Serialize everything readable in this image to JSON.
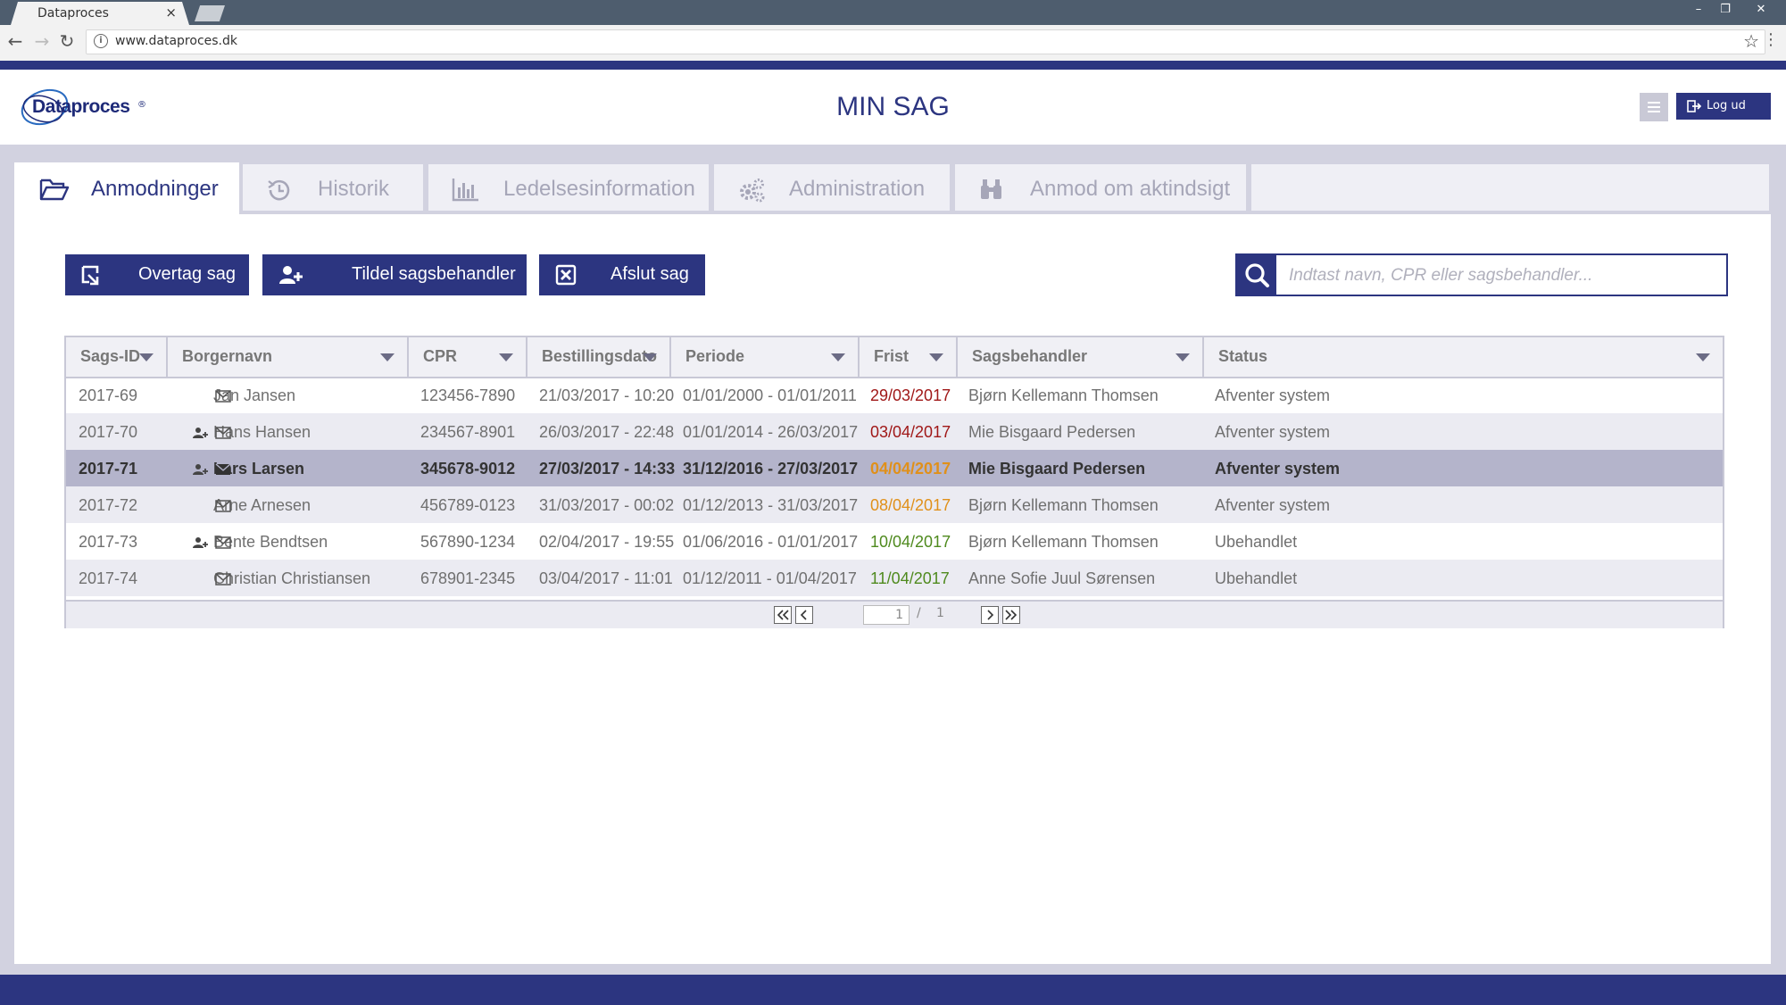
{
  "browser": {
    "tab_title": "Dataproces",
    "tab_close": "×",
    "url": "www.dataproces.dk",
    "window_controls": [
      "–",
      "❐",
      "✕"
    ]
  },
  "site": {
    "logo_text": "Dataproces",
    "logo_mark": "®",
    "page_title": "MIN SAG",
    "logout_label": "Log ud"
  },
  "tabs": [
    {
      "label": "Anmodninger",
      "icon": "folder-open-icon",
      "active": true
    },
    {
      "label": "Historik",
      "icon": "history-icon",
      "active": false
    },
    {
      "label": "Ledelsesinformation",
      "icon": "bar-chart-icon",
      "active": false
    },
    {
      "label": "Administration",
      "icon": "gears-icon",
      "active": false
    },
    {
      "label": "Anmod om aktindsigt",
      "icon": "binoculars-icon",
      "active": false
    }
  ],
  "actions": {
    "take_over": "Overtag sag",
    "assign": "Tildel sagsbehandler",
    "close": "Afslut sag"
  },
  "search": {
    "placeholder": "Indtast navn, CPR eller sagsbehandler..."
  },
  "table": {
    "columns": [
      "Sags-ID",
      "Borgernavn",
      "CPR",
      "Bestillingsdato",
      "Periode",
      "Frist",
      "Sagsbehandler",
      "Status"
    ],
    "rows": [
      {
        "id": "2017-69",
        "name": "Jan Jansen",
        "cpr": "123456-7890",
        "ordered": "21/03/2017 - 10:20",
        "period": "01/01/2000 - 01/01/2011",
        "deadline": "29/03/2017",
        "deadline_color": "#a01818",
        "handler": "Bjørn Kellemann Thomsen",
        "status": "Afventer system",
        "assigned_icon": false,
        "mail_filled": false
      },
      {
        "id": "2017-70",
        "name": "Hans Hansen",
        "cpr": "234567-8901",
        "ordered": "26/03/2017 - 22:48",
        "period": "01/01/2014 - 26/03/2017",
        "deadline": "03/04/2017",
        "deadline_color": "#a01818",
        "handler": "Mie Bisgaard Pedersen",
        "status": "Afventer system",
        "assigned_icon": true,
        "mail_filled": false
      },
      {
        "id": "2017-71",
        "name": "Lars Larsen",
        "cpr": "345678-9012",
        "ordered": "27/03/2017 - 14:33",
        "period": "31/12/2016 - 27/03/2017",
        "deadline": "04/04/2017",
        "deadline_color": "#e0901a",
        "handler": "Mie Bisgaard Pedersen",
        "status": "Afventer system",
        "assigned_icon": true,
        "mail_filled": true
      },
      {
        "id": "2017-72",
        "name": "Arne Arnesen",
        "cpr": "456789-0123",
        "ordered": "31/03/2017 - 00:02",
        "period": "01/12/2013 - 31/03/2017",
        "deadline": "08/04/2017",
        "deadline_color": "#e0901a",
        "handler": "Bjørn Kellemann Thomsen",
        "status": "Afventer system",
        "assigned_icon": false,
        "mail_filled": false
      },
      {
        "id": "2017-73",
        "name": "Bente Bendtsen",
        "cpr": "567890-1234",
        "ordered": "02/04/2017 - 19:55",
        "period": "01/06/2016 - 01/01/2017",
        "deadline": "10/04/2017",
        "deadline_color": "#4f8a1e",
        "handler": "Bjørn Kellemann Thomsen",
        "status": "Ubehandlet",
        "assigned_icon": true,
        "mail_filled": false
      },
      {
        "id": "2017-74",
        "name": "Christian Christiansen",
        "cpr": "678901-2345",
        "ordered": "03/04/2017 - 11:01",
        "period": "01/12/2011 - 01/04/2017",
        "deadline": "11/04/2017",
        "deadline_color": "#4f8a1e",
        "handler": "Anne Sofie Juul Sørensen",
        "status": "Ubehandlet",
        "assigned_icon": false,
        "mail_filled": false
      }
    ]
  },
  "pager": {
    "current_page": "1",
    "separator": "/",
    "total_pages": "1"
  },
  "colors": {
    "brand": "#2c3580",
    "frame": "#d2d2e0",
    "selected_row": "#b4b4cb"
  }
}
